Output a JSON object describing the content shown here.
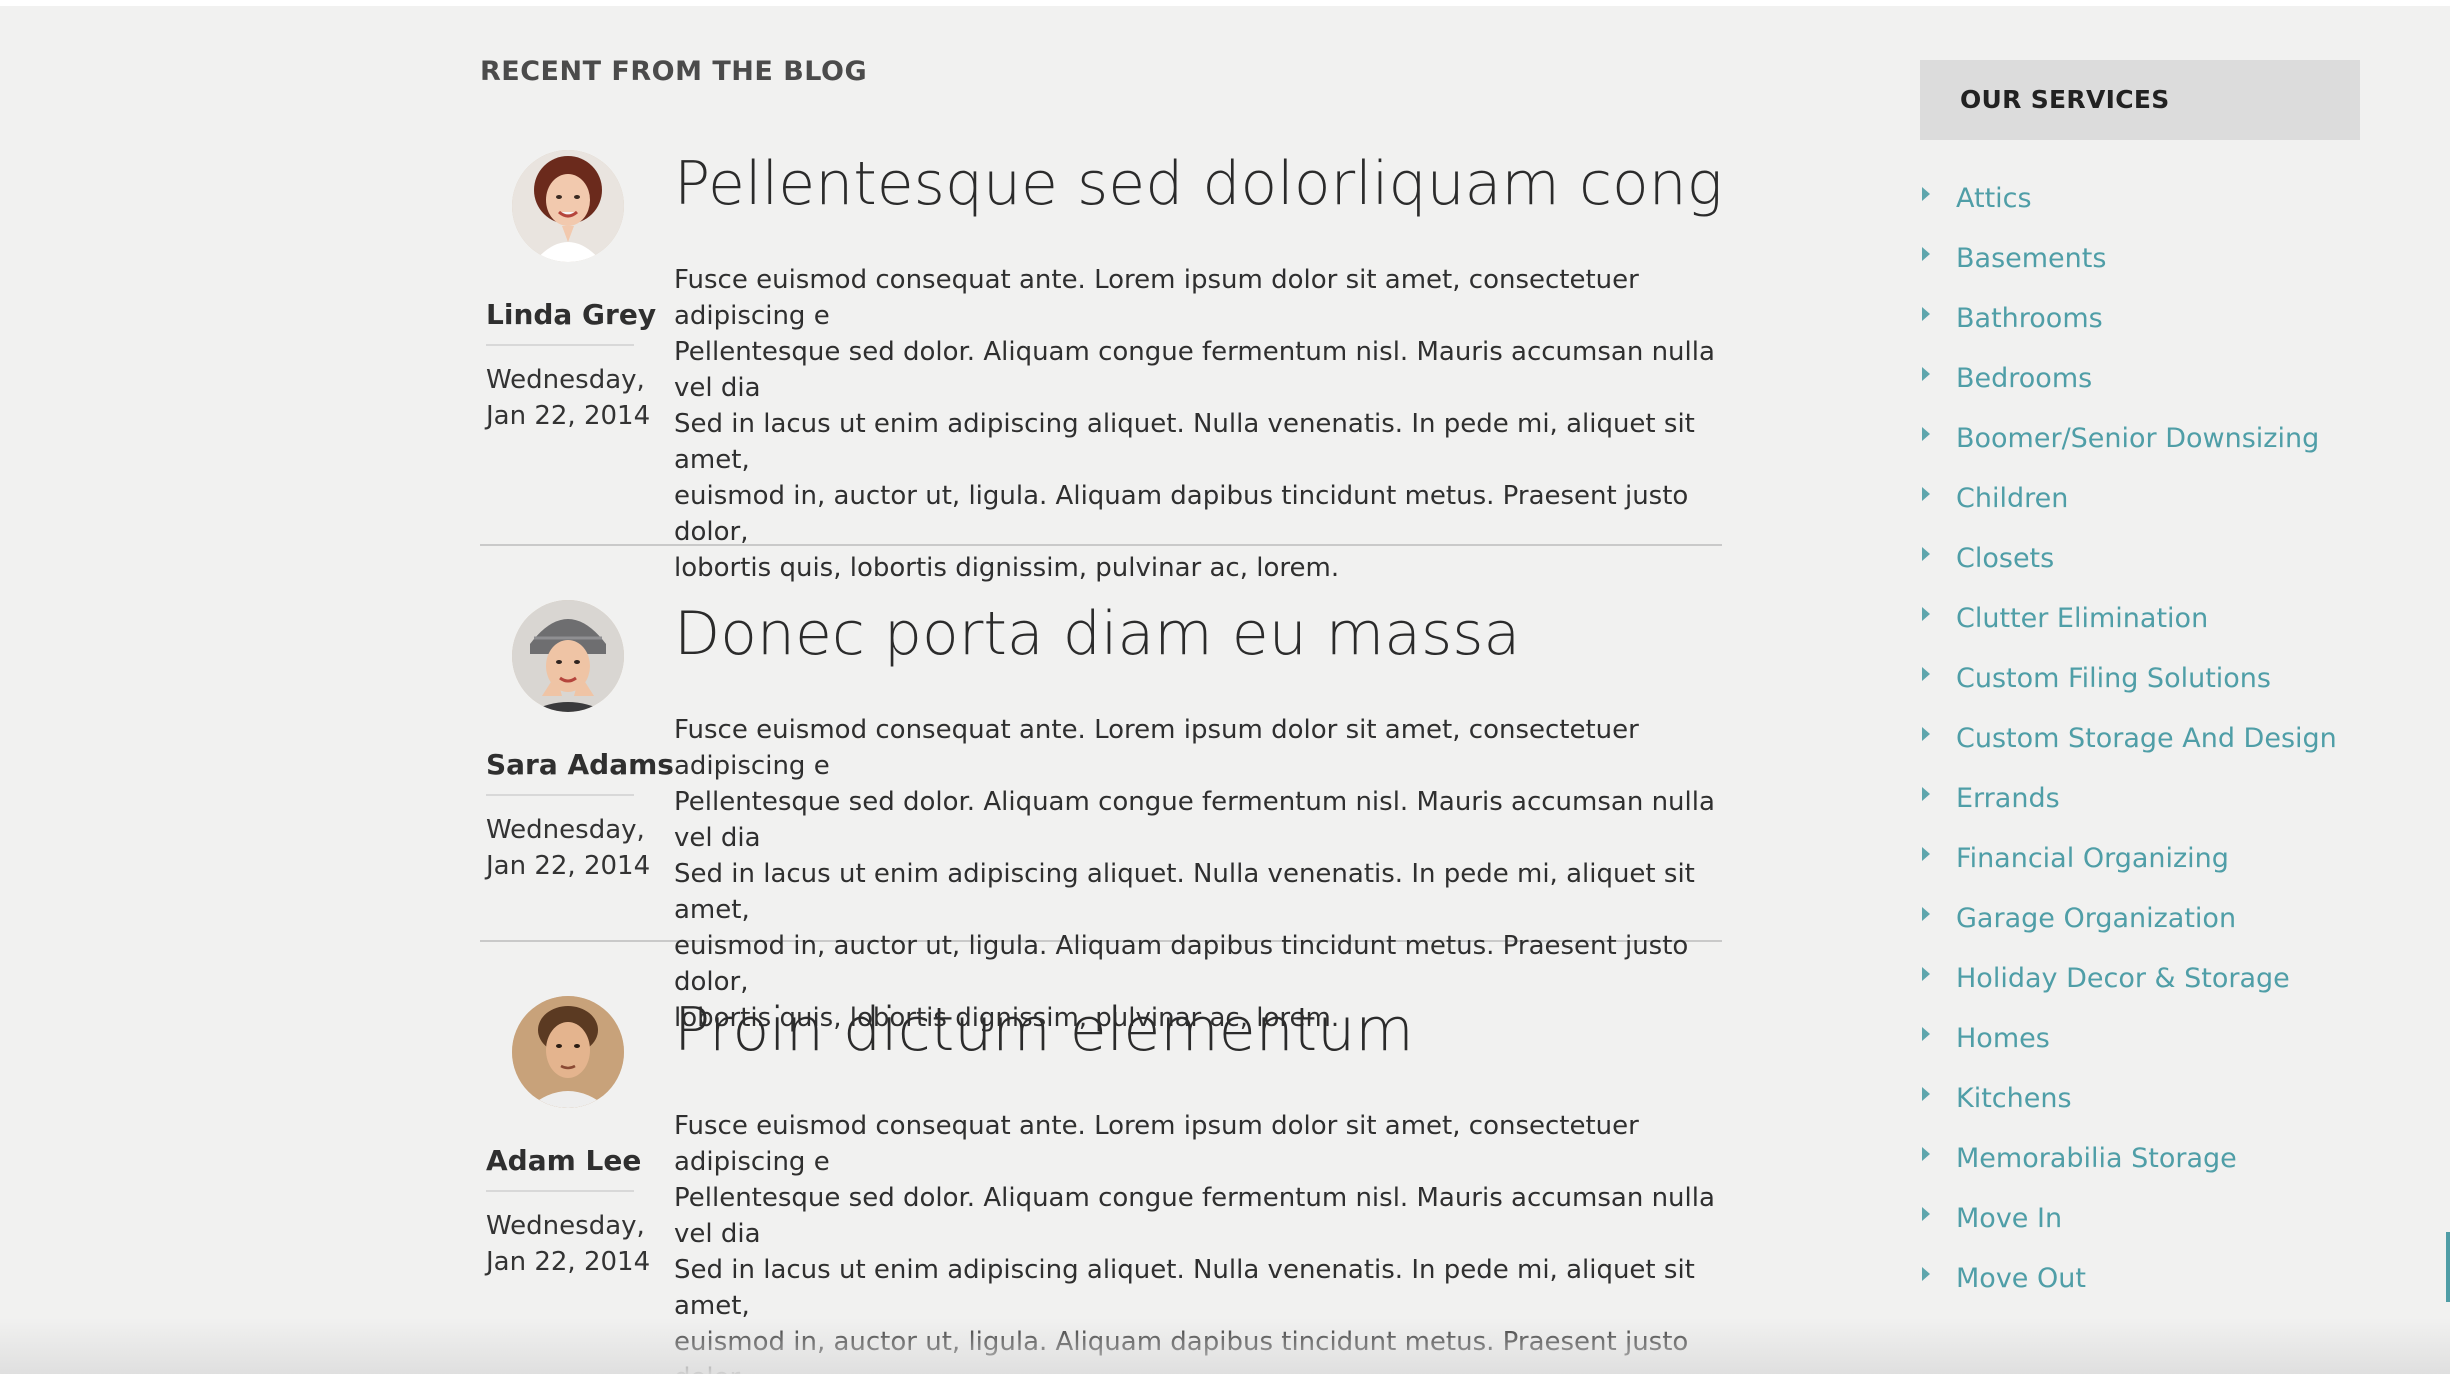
{
  "blog": {
    "heading": "RECENT FROM THE BLOG",
    "posts": [
      {
        "title": "Pellentesque sed dolorliquam congue",
        "author": "Linda Grey",
        "date": "Wednesday, Jan 22, 2014",
        "excerpt": "Fusce euismod consequat ante. Lorem ipsum dolor sit amet, consectetuer adipiscing e\nPellentesque sed dolor. Aliquam congue fermentum nisl. Mauris accumsan nulla vel dia\nSed in lacus ut enim adipiscing aliquet. Nulla venenatis. In pede mi, aliquet sit amet,\neuismod in, auctor ut, ligula. Aliquam dapibus tincidunt metus. Praesent justo dolor,\nlobortis quis, lobortis dignissim, pulvinar ac, lorem.",
        "avatar": "woman-portrait-avatar"
      },
      {
        "title": "Donec porta diam eu massa",
        "author": "Sara Adams",
        "date": "Wednesday, Jan 22, 2014",
        "excerpt": "Fusce euismod consequat ante. Lorem ipsum dolor sit amet, consectetuer adipiscing e\nPellentesque sed dolor. Aliquam congue fermentum nisl. Mauris accumsan nulla vel dia\nSed in lacus ut enim adipiscing aliquet. Nulla venenatis. In pede mi, aliquet sit amet,\neuismod in, auctor ut, ligula. Aliquam dapibus tincidunt metus. Praesent justo dolor,\nlobortis quis, lobortis dignissim, pulvinar ac, lorem.",
        "avatar": "woman-hat-avatar"
      },
      {
        "title": "Proin dictum elementum",
        "author": "Adam Lee",
        "date": "Wednesday, Jan 22, 2014",
        "excerpt": "Fusce euismod consequat ante. Lorem ipsum dolor sit amet, consectetuer adipiscing e\nPellentesque sed dolor. Aliquam congue fermentum nisl. Mauris accumsan nulla vel dia\nSed in lacus ut enim adipiscing aliquet. Nulla venenatis. In pede mi, aliquet sit amet,\neuismod in, auctor ut, ligula. Aliquam dapibus tincidunt metus. Praesent justo dolor,\nlobortis quis, lobortis dignissim, pulvinar ac, lorem.",
        "avatar": "man-portrait-avatar"
      }
    ]
  },
  "services": {
    "heading": "OUR SERVICES",
    "bullet_icon": "triangle-right-icon",
    "items": [
      "Attics",
      "Basements",
      "Bathrooms",
      "Bedrooms",
      "Boomer/Senior Downsizing",
      "Children",
      "Closets",
      "Clutter Elimination",
      "Custom Filing Solutions",
      "Custom Storage And Design",
      "Errands",
      "Financial Organizing",
      "Garage Organization",
      "Holiday Decor & Storage",
      "Homes",
      "Kitchens",
      "Memorabilia Storage",
      "Move In",
      "Move Out"
    ]
  },
  "colors": {
    "page_background": "#f1f1f0",
    "link": "#4f9ea7",
    "services_header_bg": "#dcdcdc",
    "text": "#2f2f2f"
  }
}
